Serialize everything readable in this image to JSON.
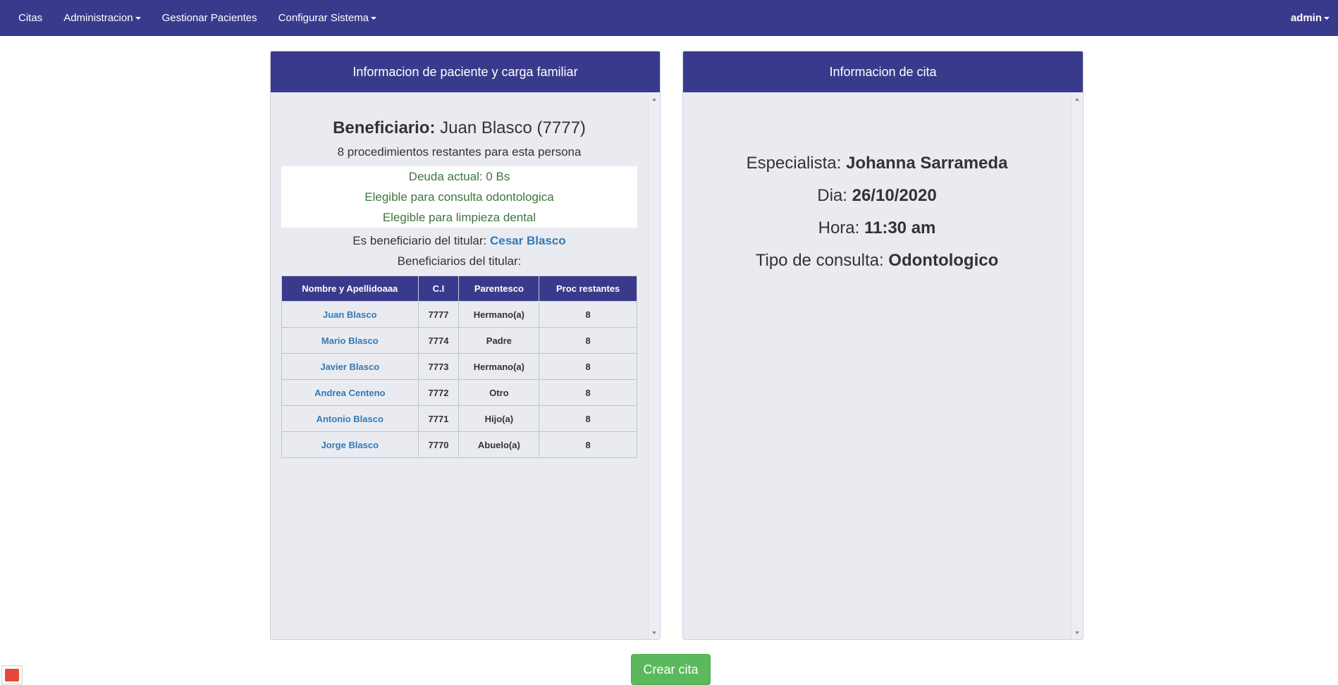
{
  "navbar": {
    "items": [
      {
        "label": "Citas",
        "dropdown": false
      },
      {
        "label": "Administracion",
        "dropdown": true
      },
      {
        "label": "Gestionar Pacientes",
        "dropdown": false
      },
      {
        "label": "Configurar Sistema",
        "dropdown": true
      }
    ],
    "user": "admin"
  },
  "patient_panel": {
    "heading": "Informacion de paciente y carga familiar",
    "beneficiary_label": "Beneficiario:",
    "beneficiary_value": "Juan Blasco (7777)",
    "procedures_remaining": "8 procedimientos restantes para esta persona",
    "status": [
      "Deuda actual: 0 Bs",
      "Elegible para consulta odontologica",
      "Elegible para limpieza dental"
    ],
    "titular_label": "Es beneficiario del titular:",
    "titular_name": "Cesar Blasco",
    "beneficiaries_title": "Beneficiarios del titular:",
    "table": {
      "headers": [
        "Nombre y Apellidoaaa",
        "C.I",
        "Parentesco",
        "Proc restantes"
      ],
      "rows": [
        [
          "Juan Blasco",
          "7777",
          "Hermano(a)",
          "8"
        ],
        [
          "Mario Blasco",
          "7774",
          "Padre",
          "8"
        ],
        [
          "Javier Blasco",
          "7773",
          "Hermano(a)",
          "8"
        ],
        [
          "Andrea Centeno",
          "7772",
          "Otro",
          "8"
        ],
        [
          "Antonio Blasco",
          "7771",
          "Hijo(a)",
          "8"
        ],
        [
          "Jorge Blasco",
          "7770",
          "Abuelo(a)",
          "8"
        ]
      ]
    }
  },
  "appointment_panel": {
    "heading": "Informacion de cita",
    "lines": [
      {
        "label": "Especialista:",
        "value": "Johanna Sarrameda"
      },
      {
        "label": "Dia:",
        "value": "26/10/2020"
      },
      {
        "label": "Hora:",
        "value": "11:30 am"
      },
      {
        "label": "Tipo de consulta:",
        "value": "Odontologico"
      }
    ]
  },
  "actions": {
    "create_label": "Crear cita"
  },
  "colors": {
    "navbar": "#3a3a8c",
    "panel_bg": "#e9ebf1",
    "success_text": "#3c763d",
    "link": "#337ab7",
    "button": "#5cb85c"
  },
  "icons": [
    "caret-down-icon",
    "scroll-up-icon",
    "scroll-down-icon",
    "app-corner-icon"
  ]
}
